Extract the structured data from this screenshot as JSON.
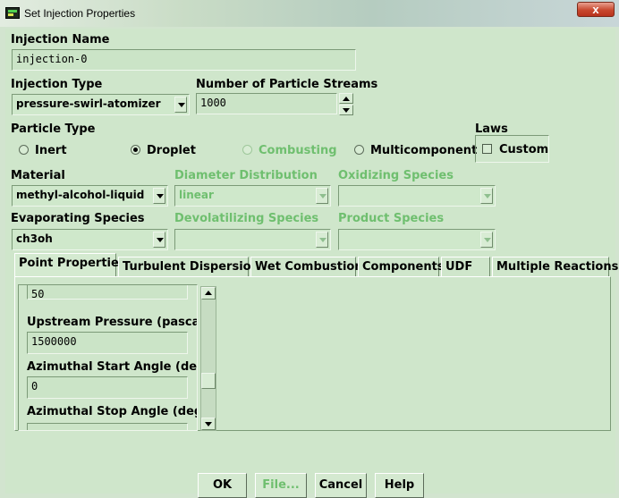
{
  "window": {
    "title": "Set Injection Properties",
    "close_label": "x"
  },
  "injection_name": {
    "label": "Injection Name",
    "value": "injection-0"
  },
  "injection_type": {
    "label": "Injection Type",
    "value": "pressure-swirl-atomizer"
  },
  "particle_streams": {
    "label": "Number of Particle Streams",
    "value": "1000"
  },
  "particle_type": {
    "label": "Particle Type",
    "options": [
      {
        "label": "Inert",
        "selected": false,
        "enabled": true
      },
      {
        "label": "Droplet",
        "selected": true,
        "enabled": true
      },
      {
        "label": "Combusting",
        "selected": false,
        "enabled": false
      },
      {
        "label": "Multicomponent",
        "selected": false,
        "enabled": true
      }
    ]
  },
  "laws": {
    "label": "Laws",
    "custom_label": "Custom",
    "custom_checked": false
  },
  "material": {
    "label": "Material",
    "value": "methyl-alcohol-liquid"
  },
  "diameter_distribution": {
    "label": "Diameter Distribution",
    "value": "linear"
  },
  "oxidizing_species": {
    "label": "Oxidizing Species",
    "value": ""
  },
  "evaporating_species": {
    "label": "Evaporating Species",
    "value": "ch3oh"
  },
  "devolatilizing_species": {
    "label": "Devolatilizing Species",
    "value": ""
  },
  "product_species": {
    "label": "Product Species",
    "value": ""
  },
  "tabs": [
    "Point Properties",
    "Turbulent Dispersion",
    "Wet Combustion",
    "Components",
    "UDF",
    "Multiple Reactions"
  ],
  "point_properties": {
    "partial_value": "50",
    "upstream_pressure": {
      "label": "Upstream Pressure (pascal)",
      "value": "1500000"
    },
    "azimuthal_start": {
      "label": "Azimuthal Start Angle (deg)",
      "value": "0"
    },
    "azimuthal_stop": {
      "label": "Azimuthal Stop Angle (deg)"
    }
  },
  "buttons": {
    "ok": "OK",
    "file": "File...",
    "cancel": "Cancel",
    "help": "Help"
  },
  "colors": {
    "background": "#cfe6cb",
    "disabled_text": "#6fbf6f",
    "close_button": "#c8482e"
  }
}
